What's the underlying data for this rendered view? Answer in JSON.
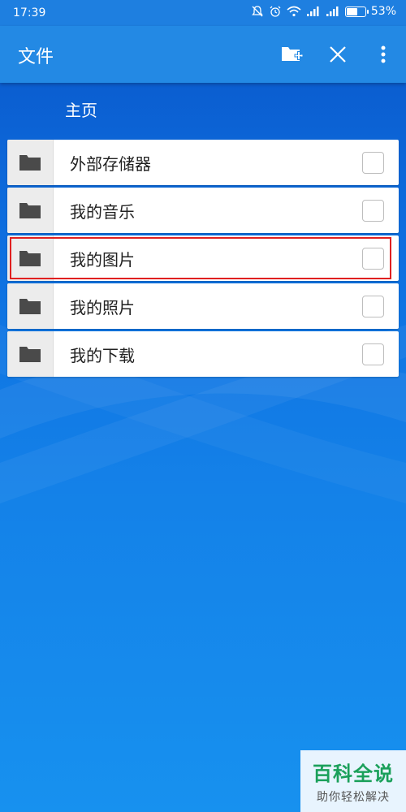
{
  "status_bar": {
    "time": "17:39",
    "battery_percent": "53%",
    "battery_level": 0.53
  },
  "app_bar": {
    "title": "文件",
    "actions": [
      {
        "icon": "new-folder-icon"
      },
      {
        "icon": "close-icon"
      },
      {
        "icon": "more-vert-icon"
      }
    ]
  },
  "breadcrumb": "主页",
  "folders": [
    {
      "label": "外部存储器",
      "checked": false
    },
    {
      "label": "我的音乐",
      "checked": false
    },
    {
      "label": "我的图片",
      "checked": false,
      "highlighted": true
    },
    {
      "label": "我的照片",
      "checked": false
    },
    {
      "label": "我的下载",
      "checked": false
    }
  ],
  "watermark": {
    "main": "百科全说",
    "sub": "助你轻松解决"
  },
  "colors": {
    "app_bar": "#2389e4",
    "background": "#0d6fe0",
    "highlight": "#e02020"
  }
}
